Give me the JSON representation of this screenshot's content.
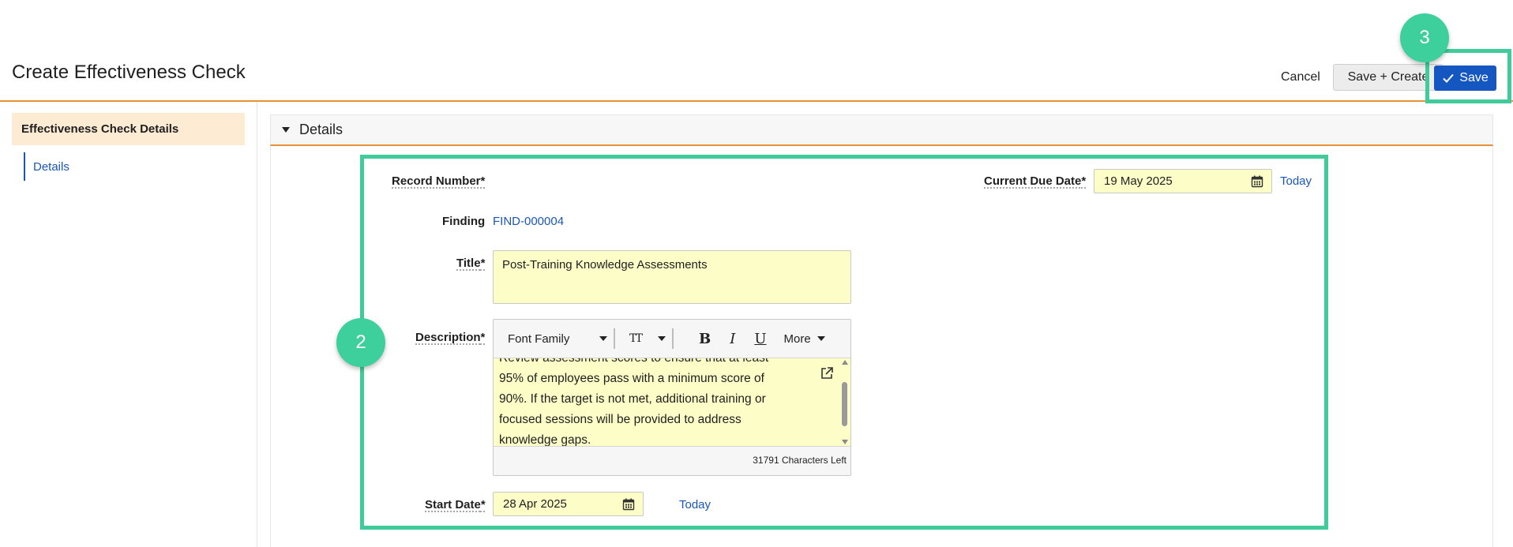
{
  "page": {
    "title": "Create Effectiveness Check"
  },
  "toolbar": {
    "cancel_label": "Cancel",
    "save_create_label": "Save + Create",
    "save_label": "Save"
  },
  "sidebar": {
    "header": "Effectiveness Check Details",
    "items": [
      {
        "label": "Details"
      }
    ]
  },
  "section": {
    "title": "Details"
  },
  "form": {
    "record_number": {
      "label": "Record Number",
      "required": "*"
    },
    "current_due_date": {
      "label": "Current Due Date",
      "required": "*",
      "value": "19 May 2025",
      "today_label": "Today"
    },
    "finding": {
      "label": "Finding",
      "value": "FIND-000004"
    },
    "title": {
      "label": "Title",
      "required": "*",
      "value": "Post-Training Knowledge Assessments"
    },
    "description": {
      "label": "Description",
      "required": "*",
      "toolbar": {
        "font_family": "Font Family",
        "font_size_icon": "TT",
        "bold": "B",
        "italic": "I",
        "underline": "U",
        "more": "More"
      },
      "lines": [
        "Review assessment scores to ensure that at least",
        "95% of employees pass with a minimum score of",
        "90%. If the target is not met, additional training or",
        "focused sessions will be provided to address",
        "knowledge gaps."
      ],
      "chars_left": "31791 Characters Left"
    },
    "start_date": {
      "label": "Start Date",
      "required": "*",
      "value": "28 Apr 2025",
      "today_label": "Today"
    }
  },
  "annotations": {
    "badge_form": "2",
    "badge_save": "3",
    "highlight_color": "#3fcc9a"
  },
  "colors": {
    "accent": "#e8913a",
    "primary": "#1557c0",
    "field_bg": "#fdfdc7",
    "link": "#1a56b8"
  }
}
